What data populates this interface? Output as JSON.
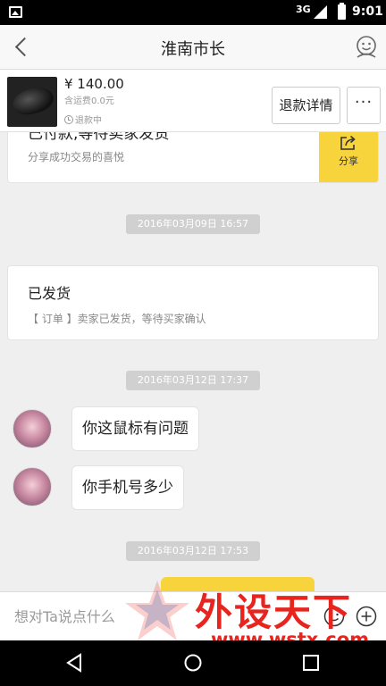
{
  "status_bar": {
    "network": "3G",
    "time": "9:01"
  },
  "header": {
    "title": "淮南市长"
  },
  "order": {
    "price": "¥ 140.00",
    "shipping": "含运费0.0元",
    "status": "退款中",
    "refund_button": "退款详情",
    "more_button": "···"
  },
  "messages": {
    "card_payment": {
      "title": "已付款,等待卖家发货",
      "subtitle": "分享成功交易的喜悦",
      "share_label": "分享"
    },
    "time1": "2016年03月09日 16:57",
    "card_shipped": {
      "title": "已发货",
      "subtitle": "【 订单 】卖家已发货，等待买家确认"
    },
    "time2": "2016年03月12日 17:37",
    "bubble1": "你这鼠标有问题",
    "bubble2": "你手机号多少",
    "time3": "2016年03月12日 17:53"
  },
  "input": {
    "placeholder": "想对Ta说点什么"
  },
  "watermark": {
    "main": "外设天下",
    "url": "www.wstx.com"
  },
  "colors": {
    "accent_yellow": "#f8d43c",
    "watermark_red": "#e8241f"
  }
}
